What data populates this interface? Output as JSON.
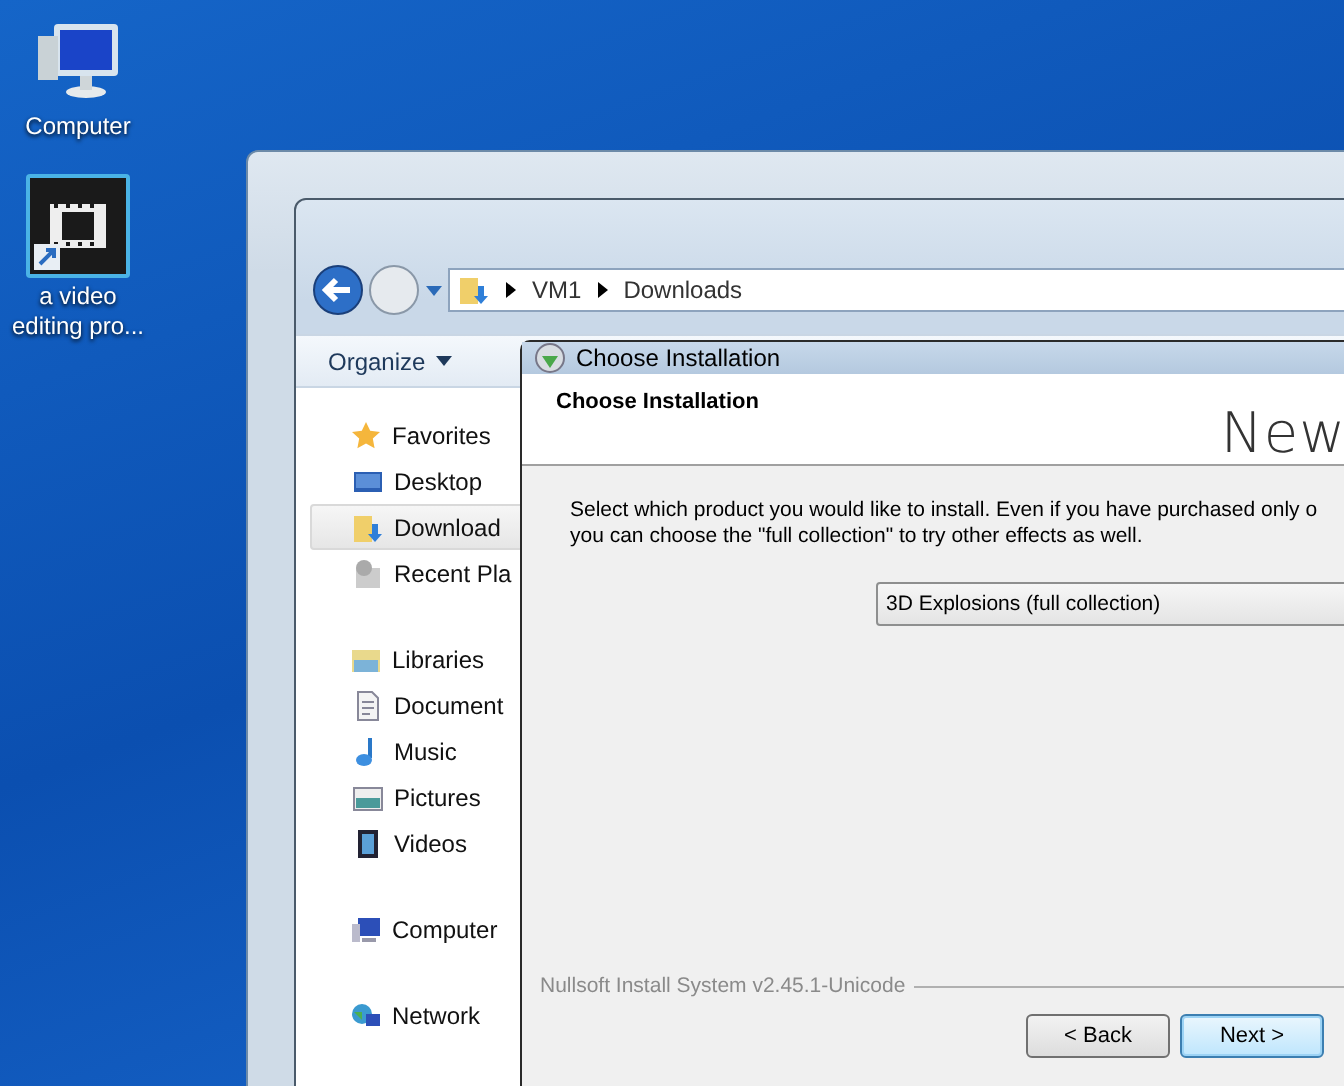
{
  "desktop_icons": [
    {
      "label": "Computer",
      "kind": "computer",
      "selected": false
    },
    {
      "label": "a video editing pro...",
      "kind": "video-shortcut",
      "selected": true
    }
  ],
  "explorer": {
    "breadcrumb": [
      "VM1",
      "Downloads"
    ],
    "toolbar": {
      "organize": "Organize"
    },
    "nav_pane": [
      {
        "label": "Favorites",
        "kind": "star",
        "children": [
          {
            "label": "Desktop",
            "kind": "desktop",
            "selected": false
          },
          {
            "label": "Download",
            "kind": "downloads",
            "selected": true
          },
          {
            "label": "Recent Pla",
            "kind": "recent",
            "selected": false
          }
        ]
      },
      {
        "label": "Libraries",
        "kind": "library",
        "children": [
          {
            "label": "Document",
            "kind": "documents",
            "selected": false
          },
          {
            "label": "Music",
            "kind": "music",
            "selected": false
          },
          {
            "label": "Pictures",
            "kind": "pictures",
            "selected": false
          },
          {
            "label": "Videos",
            "kind": "videos",
            "selected": false
          }
        ]
      },
      {
        "label": "Computer",
        "kind": "computer"
      },
      {
        "label": "Network",
        "kind": "network"
      }
    ]
  },
  "installer": {
    "title": "Choose Installation",
    "header_title": "Choose Installation",
    "brand": "New",
    "description": "Select which product you would like to install. Even if you have purchased only o",
    "description_line_2": "you can choose the \"full collection\" to try other effects as well.",
    "product_select": {
      "value": "3D Explosions (full collection)"
    },
    "footer": "Nullsoft Install System v2.45.1-Unicode",
    "buttons": [
      {
        "label": "< Back",
        "default": false
      },
      {
        "label": "Next >",
        "default": true
      }
    ]
  }
}
